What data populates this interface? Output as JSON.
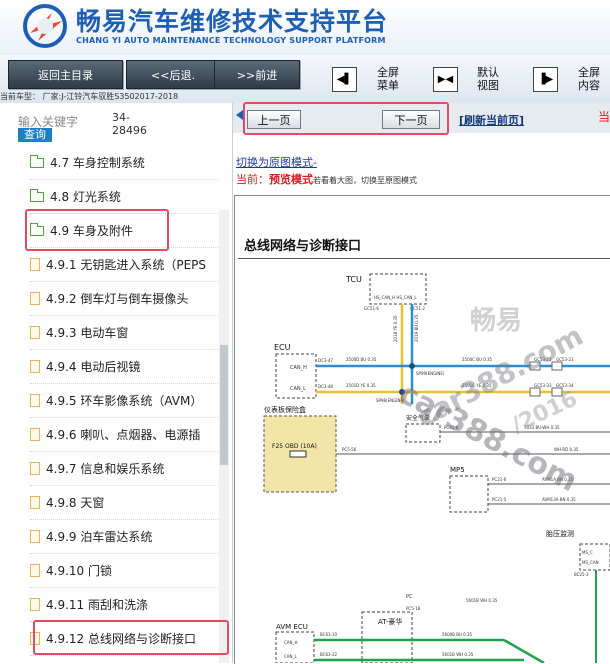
{
  "header": {
    "title_cn": "畅易汽车维修技术支持平台",
    "title_en": "CHANG YI AUTO MAINTENANCE TECHNOLOGY SUPPORT PLATFORM"
  },
  "toolbar": {
    "home": "返回主目录",
    "back": "<<后退.",
    "forward": ">>前进",
    "view_full_menu": "全屏菜单",
    "view_default": "默认视图",
    "view_full_content": "全屏内容"
  },
  "car_info": "当前车型：   厂家:J-江铃汽车驭胜S3502017-2018",
  "search": {
    "label": "输入关键字",
    "code": "34-28496",
    "button": "查询"
  },
  "tree": {
    "items": [
      {
        "label": "4.7 车身控制系统",
        "type": "folder"
      },
      {
        "label": "4.8 灯光系统",
        "type": "folder"
      },
      {
        "label": "4.9 车身及附件",
        "type": "folder"
      },
      {
        "label": "4.9.1 无钥匙进入系统（PEPS",
        "type": "doc"
      },
      {
        "label": "4.9.2 倒车灯与倒车摄像头",
        "type": "doc"
      },
      {
        "label": "4.9.3 电动车窗",
        "type": "doc"
      },
      {
        "label": "4.9.4 电动后视镜",
        "type": "doc"
      },
      {
        "label": "4.9.5 环车影像系统（AVM）",
        "type": "doc"
      },
      {
        "label": "4.9.6 喇叭、点烟器、电源插",
        "type": "doc"
      },
      {
        "label": "4.9.7 信息和娱乐系统",
        "type": "doc"
      },
      {
        "label": "4.9.8 天窗",
        "type": "doc"
      },
      {
        "label": "4.9.9 泊车雷达系统",
        "type": "doc"
      },
      {
        "label": "4.9.10 门锁",
        "type": "doc"
      },
      {
        "label": "4.9.11 雨刮和洗涤",
        "type": "doc"
      },
      {
        "label": "4.9.12 总线网络与诊断接口",
        "type": "doc"
      }
    ]
  },
  "pager": {
    "prev": "上一页",
    "next": "下一页",
    "refresh": "[刷新当前页]",
    "right_partial": "当"
  },
  "mode": {
    "switch_link": "切换为原图模式-",
    "current_prefix": "当前：",
    "current_mode": "预览模式",
    "current_note": "若看着大图，切换至原图模式"
  },
  "doc": {
    "title": "总线网络与诊断接口",
    "diagram_labels": {
      "tcu": "TCU",
      "tcu_pin": "HS_CAN_H HS_CAN_L",
      "gc51_6": "GC51-6",
      "gc51_2": "GC51-2",
      "ecu": "ECU",
      "can_h": "CAN_H",
      "can_l": "CAN_L",
      "dc3_47": "DC3-47",
      "dc3_48": "DC3-48",
      "w_2500d": "2500D BU 0.35",
      "w_2501d": "2501D YE 0.35",
      "w_2500c": "2500C BU 0.35",
      "w_2501c": "2501C YE 0.35",
      "sp99": "SP99(ENGINE)",
      "sp98": "SP98(ENGINE)",
      "gc53_22": "GC53-22",
      "gc53_33": "GC53-33",
      "gc53_23": "GC53-23",
      "gc53_34": "GC53-34",
      "w_2018": "2018 YE 0.35",
      "w_2019": "2019 BU 0.35",
      "fuse_box": "仪表板保险盒",
      "f25": "F25 OBD (10A)",
      "pc5_56": "PC5-56",
      "airbag": "安全气囊",
      "pc41_8": "PC41-8",
      "w_7033": "7033 BU-WH 0.35",
      "w_rd": "WH-RD 0.35",
      "mp5": "MP5",
      "pc21_6": "PC21-6",
      "pc21_5": "PC21-5",
      "w_avm1a": "AVM1A BN 0.35",
      "w_avm13": "AVM13A BN 0.35",
      "tire": "胎压监测",
      "ms_c": "MS_C",
      "ms_can": "MS_CAN",
      "bc25_3": "BC25-3",
      "pc": "PC",
      "pc5_18": "PC5-18",
      "w_5601b_wh": "5601B WH 0.35",
      "avm_ecu": "AVM ECU",
      "at_luxury": "AT-豪华",
      "bc63_10": "BC63-10",
      "bc63_22": "BC63-22",
      "w_5600b": "5600B BU 0.35",
      "w_5601b": "5601B WH 0.35"
    },
    "watermark_1": "畅易",
    "watermark_2": "car388.com",
    "watermark_3": "/2016"
  },
  "colors": {
    "brand": "#1d5fb4",
    "highlight": "#e34b63",
    "can_high": "#2a8fd0",
    "can_low": "#e9c12c",
    "green_wire": "#1fa24a"
  }
}
